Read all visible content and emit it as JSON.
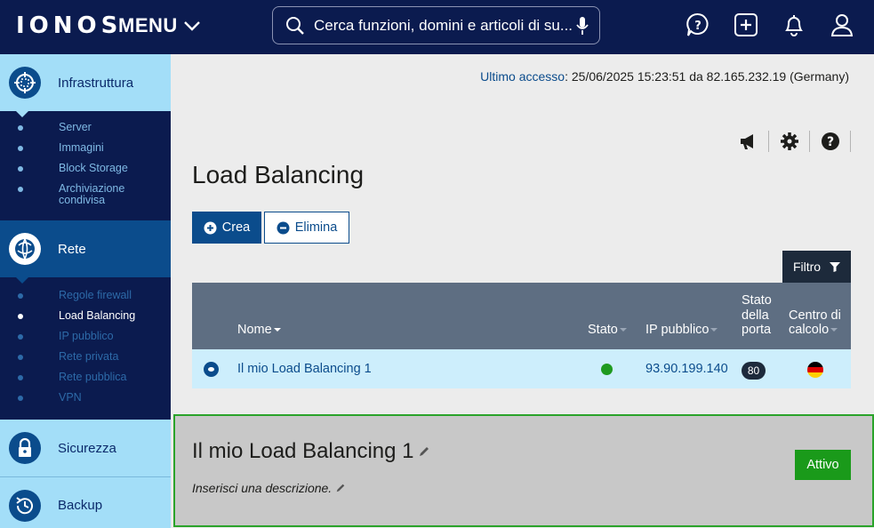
{
  "header": {
    "logo": "IONOS",
    "menu_label": "MENU",
    "search_placeholder": "Cerca funzioni, domini e articoli di su...",
    "icons": [
      "help-chat-icon",
      "add-icon",
      "bell-icon",
      "user-icon"
    ]
  },
  "sidebar": {
    "sections": [
      {
        "label": "Infrastruttura",
        "icon": "infrastructure-icon",
        "active": false,
        "items": [
          {
            "label": "Server"
          },
          {
            "label": "Immagini"
          },
          {
            "label": "Block Storage"
          },
          {
            "label": "Archiviazione condivisa"
          }
        ]
      },
      {
        "label": "Rete",
        "icon": "network-icon",
        "active": true,
        "items": [
          {
            "label": "Regole firewall"
          },
          {
            "label": "Load Balancing",
            "current": true
          },
          {
            "label": "IP pubblico"
          },
          {
            "label": "Rete privata"
          },
          {
            "label": "Rete pubblica"
          },
          {
            "label": "VPN"
          }
        ]
      },
      {
        "label": "Sicurezza",
        "icon": "lock-icon",
        "active": false
      },
      {
        "label": "Backup",
        "icon": "backup-icon",
        "active": false
      }
    ]
  },
  "main": {
    "last_access_label": "Ultimo accesso",
    "last_access_value": ": 25/06/2025 15:23:51 da 82.165.232.19 (Germany)",
    "page_title": "Load Balancing",
    "buttons": {
      "create": "Crea",
      "delete": "Elimina",
      "filter": "Filtro"
    },
    "table": {
      "columns": [
        "Nome",
        "Stato",
        "IP pubblico",
        "Stato della porta",
        "Centro di calcolo"
      ],
      "rows": [
        {
          "name": "Il mio Load Balancing 1",
          "status": "active",
          "public_ip": "93.90.199.140",
          "port_state": "80",
          "datacenter": "Germany"
        }
      ]
    },
    "detail": {
      "title": "Il mio Load Balancing 1",
      "description": "Inserisci una descrizione.",
      "status_label": "Attivo"
    }
  },
  "colors": {
    "navy": "#0b1b4f",
    "brand_blue": "#0b4c8c",
    "light_blue": "#a3def8",
    "table_header": "#5e6e82",
    "success": "#1a9a1a"
  }
}
